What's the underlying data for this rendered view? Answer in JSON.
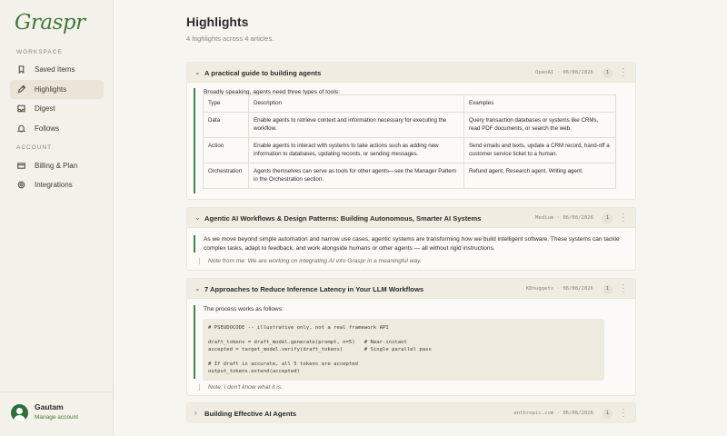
{
  "app": {
    "logo": "Graspr"
  },
  "sidebar": {
    "workspace_label": "WORKSPACE",
    "account_label": "ACCOUNT",
    "workspace_items": [
      {
        "label": "Saved Items",
        "icon": "bookmark-icon"
      },
      {
        "label": "Highlights",
        "icon": "pen-icon",
        "active": true
      },
      {
        "label": "Digest",
        "icon": "inbox-icon"
      },
      {
        "label": "Follows",
        "icon": "bell-icon"
      }
    ],
    "account_items": [
      {
        "label": "Billing & Plan",
        "icon": "credit-card-icon"
      },
      {
        "label": "Integrations",
        "icon": "gear-icon"
      }
    ],
    "user": {
      "name": "Gautam",
      "manage_label": "Manage account"
    }
  },
  "main": {
    "title": "Highlights",
    "subtitle": "4 highlights across 4 articles.",
    "cards": [
      {
        "title": "A practical guide to building agents",
        "source": "OpenAI",
        "date": "06/08/2026",
        "count": "1",
        "intro": "Broadly speaking, agents need three types of tools:",
        "table": {
          "headers": [
            "Type",
            "Description",
            "Examples"
          ],
          "rows": [
            [
              "Data",
              "Enable agents to retrieve context and information necessary for executing the workflow.",
              "Query transaction databases or systems like CRMs, read PDF documents, or search the web."
            ],
            [
              "Action",
              "Enable agents to interact with systems to take actions such as adding new information to databases, updating records, or sending messages.",
              "Send emails and texts, update a CRM record, hand-off a customer service ticket to a human."
            ],
            [
              "Orchestration",
              "Agents themselves can serve as tools for other agents—see the Manager Pattern in the Orchestration section.",
              "Refund agent, Research agent, Writing agent."
            ]
          ]
        }
      },
      {
        "title": "Agentic AI Workflows & Design Patterns: Building Autonomous, Smarter AI Systems",
        "source": "Medium",
        "date": "06/08/2026",
        "count": "1",
        "quote": "As we move beyond simple automation and narrow use cases, agentic systems are transforming how we build intelligent software. These systems can tackle complex tasks, adapt to feedback, and work alongside humans or other agents — all without rigid instructions.",
        "note": "Note from me: We are working on integrating AI into Graspr in a meaningful way."
      },
      {
        "title": "7 Approaches to Reduce Inference Latency in Your LLM Workflows",
        "source": "KDnuggets",
        "date": "06/08/2026",
        "count": "1",
        "intro": "The process works as follows:",
        "code": "# PSEUDOCODE -- illustrative only, not a real framework API\n\ndraft_tokens = draft_model.generate(prompt, n=5)   # Near-instant\naccepted = target_model.verify(draft_tokens)       # Single parallel pass\n\n# If draft is accurate, all 5 tokens are accepted\noutput_tokens.extend(accepted)",
        "note": "Note: I don't know what it is."
      },
      {
        "title": "Building Effective AI Agents",
        "source": "anthropic.com",
        "date": "06/08/2026",
        "count": "1"
      }
    ]
  },
  "colors": {
    "accent": "#3f7a3a",
    "quote_bar": "#3a8a45",
    "sidebar_bg": "#f4f1ea",
    "page_bg": "#f7f5f0"
  }
}
